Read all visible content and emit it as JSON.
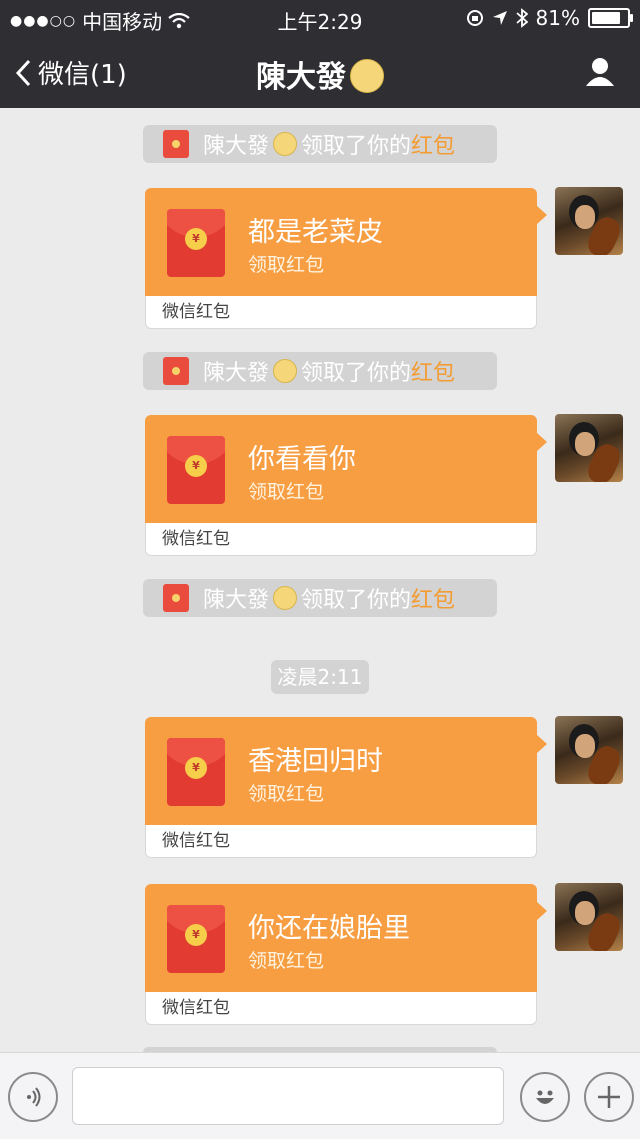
{
  "status_bar": {
    "carrier": "中国移动",
    "signal_dots": "●●●○○",
    "time": "上午2:29",
    "battery": "81%",
    "battery_level": 0.81
  },
  "nav": {
    "back_label": "微信(1)",
    "title": "陳大發"
  },
  "notices": [
    {
      "name": "陳大發",
      "text": "领取了你的",
      "link": "红包"
    },
    {
      "name": "陳大發",
      "text": "领取了你的",
      "link": "红包"
    },
    {
      "name": "陳大發",
      "text": "领取了你的",
      "link": "红包"
    }
  ],
  "timestamp": "凌晨2:11",
  "messages": [
    {
      "title": "都是老菜皮",
      "subtitle": "领取红包",
      "footer": "微信红包"
    },
    {
      "title": "你看看你",
      "subtitle": "领取红包",
      "footer": "微信红包"
    },
    {
      "title": "香港回归时",
      "subtitle": "领取红包",
      "footer": "微信红包"
    },
    {
      "title": "你还在娘胎里",
      "subtitle": "领取红包",
      "footer": "微信红包"
    }
  ],
  "envelope_coin": "¥",
  "colors": {
    "nav_bg": "#2e2e33",
    "red_packet": "#f79d42",
    "red_link": "#f39c33",
    "chat_bg": "#ebebeb"
  },
  "input_bar": {
    "voice_icon": "voice-icon",
    "emoji_icon": "emoji-icon",
    "plus_icon": "plus-icon",
    "text_value": ""
  }
}
